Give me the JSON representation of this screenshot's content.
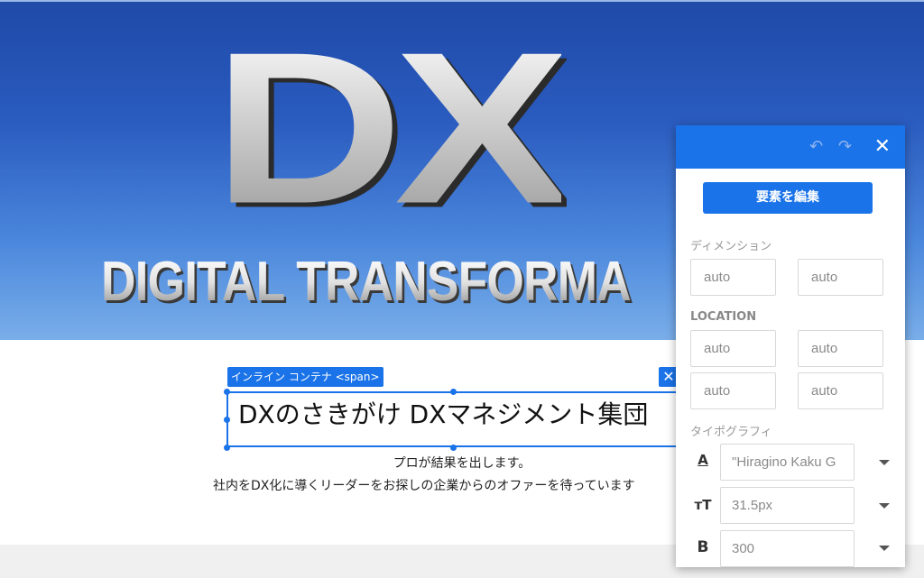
{
  "hero": {
    "big_text": "DX",
    "sub_text": "DIGITAL TRANSFORMA"
  },
  "content": {
    "selection_label": "インライン コンテナ <span>",
    "close_chip": "✕",
    "headline": "DXのさきがけ DXマネジメント集団",
    "tagline_1": "プロが結果を出します。",
    "tagline_2": "社内をDX化に導くリーダーをお探しの企業からのオファーを待っています"
  },
  "panel": {
    "undo_icon": "↶",
    "redo_icon": "↷",
    "close_icon": "✕",
    "edit_button": "要素を編集",
    "dimension_title": "ディメンション",
    "dimension_width": "auto",
    "dimension_height": "auto",
    "location_title": "LOCATION",
    "location_top": "auto",
    "location_right": "auto",
    "location_bottom": "auto",
    "location_left": "auto",
    "typography_title": "タイポグラフィ",
    "font_family_icon": "A",
    "font_family": "\"Hiragino Kaku G",
    "font_size_icon": "тT",
    "font_size": "31.5px",
    "font_weight_icon": "B",
    "font_weight": "300"
  },
  "colors": {
    "accent": "#1a73e8",
    "hero_top": "#1f4aa8",
    "hero_bottom": "#79aee9"
  }
}
